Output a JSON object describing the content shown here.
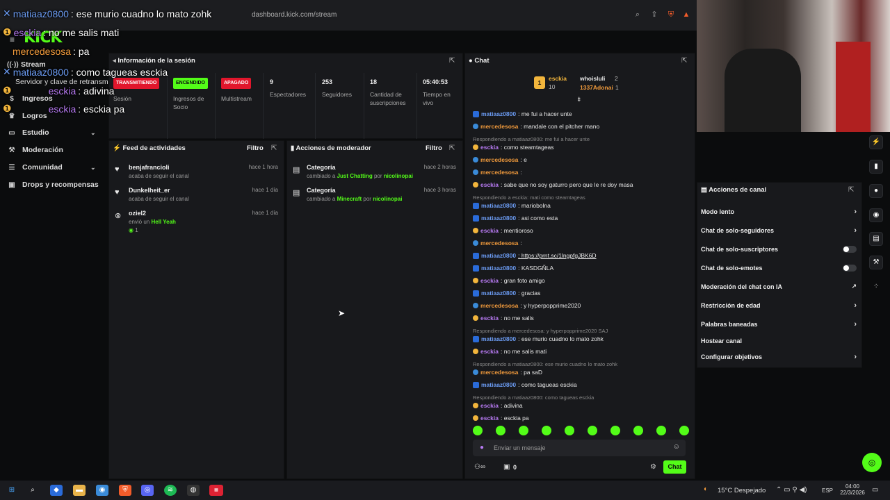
{
  "browser": {
    "url": "dashboard.kick.com/stream"
  },
  "overlay_chat": [
    {
      "user": "matiaaz0800",
      "text": ": ese murio cuadno lo mato zohk"
    },
    {
      "user": "esckia",
      "text": ": no me salis mati"
    },
    {
      "user": "mercedesosa",
      "text": ": pa"
    },
    {
      "user": "matiaaz0800",
      "text": ": como tagueas esckia"
    },
    {
      "user": "esckia",
      "text": ": adivina"
    },
    {
      "user": "esckia",
      "text": ": esckia pa"
    }
  ],
  "logo": "KICK",
  "nav": {
    "items": [
      {
        "label": "Stream",
        "icon": "broadcast-icon"
      },
      {
        "label": "Servidor y clave de retransm",
        "icon": ""
      },
      {
        "label": "Ingresos",
        "icon": "dollar-icon"
      },
      {
        "label": "Logros",
        "icon": "trophy-icon"
      },
      {
        "label": "Estudio",
        "icon": "monitor-icon"
      },
      {
        "label": "Moderación",
        "icon": "wrench-icon"
      },
      {
        "label": "Comunidad",
        "icon": "users-icon"
      },
      {
        "label": "Drops y recompensas",
        "icon": "gift-icon"
      }
    ]
  },
  "session": {
    "title": "Información de la sesión",
    "stats": [
      {
        "badge": "TRANSMITIENDO",
        "label": "Sesión",
        "color": "#e1162c"
      },
      {
        "badge": "ENCENDIDO",
        "label": "Ingresos de Socio",
        "color": "#53fc18"
      },
      {
        "badge": "APAGADO",
        "label": "Multistream",
        "color": "#e1162c"
      },
      {
        "value": "9",
        "label": "Espectadores"
      },
      {
        "value": "253",
        "label": "Seguidores"
      },
      {
        "value": "18",
        "label": "Cantidad de suscripciones"
      },
      {
        "value": "05:40:53",
        "label": "Tiempo en vivo"
      }
    ]
  },
  "activity": {
    "title": "Feed de actividades",
    "filter": "Filtro",
    "items": [
      {
        "name": "benjafrancioli",
        "desc": "acaba de seguir el canal",
        "time": "hace 1 hora"
      },
      {
        "name": "Dunkelheit_er",
        "desc": "acaba de seguir el canal",
        "time": "hace 1 día"
      },
      {
        "name": "oziel2",
        "desc": "envió un",
        "highlight": "Hell Yeah",
        "count": "1",
        "time": "hace 1 día"
      }
    ]
  },
  "modactions": {
    "title": "Acciones de moderador",
    "filter": "Filtro",
    "items": [
      {
        "name": "Categoría",
        "pre": "cambiado a",
        "cat": "Just Chatting",
        "por": "por",
        "by": "nicolinopai",
        "time": "hace 2 horas"
      },
      {
        "name": "Categoría",
        "pre": "cambiado a",
        "cat": "Minecraft",
        "por": "por",
        "by": "nicolinopai",
        "time": "hace 3 horas"
      }
    ]
  },
  "chat": {
    "title": "Chat",
    "leaders": [
      {
        "rank": "1",
        "name": "esckia",
        "value": "10"
      },
      {
        "name": "whoisluli",
        "value": "2"
      },
      {
        "name": "1337Adonai",
        "value": "1"
      }
    ],
    "lines": [
      {
        "type": "msg",
        "user": "matiaaz0800",
        "color": "blue",
        "text": ": me fui a hacer unte"
      },
      {
        "type": "msg",
        "user": "mercedesosa",
        "color": "orange",
        "text": ": mandale con el pitcher mano"
      },
      {
        "type": "reply",
        "text": "Respondiendo a matiaaz0800: me fui a hacer unte"
      },
      {
        "type": "msg",
        "user": "esckia",
        "color": "purple",
        "text": ": como steamtageas"
      },
      {
        "type": "msg",
        "user": "mercedesosa",
        "color": "orange",
        "text": ": e"
      },
      {
        "type": "msg",
        "user": "mercedesosa",
        "color": "orange",
        "text": ":"
      },
      {
        "type": "msg",
        "user": "esckia",
        "color": "purple",
        "text": ": sabe que no soy gaturro pero que le re doy masa"
      },
      {
        "type": "reply",
        "text": "Respondiendo a esckia: mati como steamtageas"
      },
      {
        "type": "msg",
        "user": "matiaaz0800",
        "color": "blue",
        "text": ": mariobolna"
      },
      {
        "type": "msg",
        "user": "matiaaz0800",
        "color": "blue",
        "text": ": asi como esta"
      },
      {
        "type": "msg",
        "user": "esckia",
        "color": "purple",
        "text": ": mentioroso"
      },
      {
        "type": "msg",
        "user": "mercedesosa",
        "color": "orange",
        "text": ":"
      },
      {
        "type": "msg",
        "user": "matiaaz0800",
        "color": "blue",
        "text": ": https://prnt.sc/1lngpfgJBK6D"
      },
      {
        "type": "msg",
        "user": "matiaaz0800",
        "color": "blue",
        "text": ": KASDGÑLA"
      },
      {
        "type": "msg",
        "user": "esckia",
        "color": "purple",
        "text": ": gran foto amigo"
      },
      {
        "type": "msg",
        "user": "matiaaz0800",
        "color": "blue",
        "text": ": gracias"
      },
      {
        "type": "msg",
        "user": "mercedesosa",
        "color": "orange",
        "text": ": y hyperpopprime2020"
      },
      {
        "type": "msg",
        "user": "esckia",
        "color": "purple",
        "text": ": no me salis"
      },
      {
        "type": "reply",
        "text": "Respondiendo a mercedesosa: y hyperpopprime2020 SAJ"
      },
      {
        "type": "msg",
        "user": "matiaaz0800",
        "color": "blue",
        "text": ": ese murio cuadno lo mato zohk"
      },
      {
        "type": "msg",
        "user": "esckia",
        "color": "purple",
        "text": ": no me salis mati"
      },
      {
        "type": "reply",
        "text": "Respondiendo a matiaaz0800: ese murio cuadno lo mato zohk"
      },
      {
        "type": "msg",
        "user": "mercedesosa",
        "color": "orange",
        "text": ": pa saD"
      },
      {
        "type": "msg",
        "user": "matiaaz0800",
        "color": "blue",
        "text": ": como tagueas esckia"
      },
      {
        "type": "reply",
        "text": "Respondiendo a matiaaz0800: como tagueas esckia"
      },
      {
        "type": "msg",
        "user": "esckia",
        "color": "purple",
        "text": ": adivina"
      },
      {
        "type": "msg",
        "user": "esckia",
        "color": "purple",
        "text": ": esckia pa"
      }
    ],
    "input_placeholder": "Enviar un mensaje",
    "count": "0",
    "send": "Chat"
  },
  "channel_actions": {
    "title": "Acciones de canal",
    "items": [
      {
        "label": "Modo lento",
        "control": "chevron"
      },
      {
        "label": "Chat de solo-seguidores",
        "control": "chevron"
      },
      {
        "label": "Chat de solo-suscriptores",
        "control": "toggle"
      },
      {
        "label": "Chat de solo-emotes",
        "control": "toggle"
      },
      {
        "label": "Moderación del chat con IA",
        "control": "external"
      },
      {
        "label": "Restricción de edad",
        "control": "chevron"
      },
      {
        "label": "Palabras baneadas",
        "control": "chevron"
      },
      {
        "label": "Hostear canal",
        "control": "none"
      },
      {
        "label": "Configurar objetivos",
        "control": "chevron"
      }
    ]
  },
  "taskbar": {
    "weather": "15°C  Despejado",
    "lang": "ESP",
    "time": "04:00",
    "date": "22/3/2026"
  }
}
